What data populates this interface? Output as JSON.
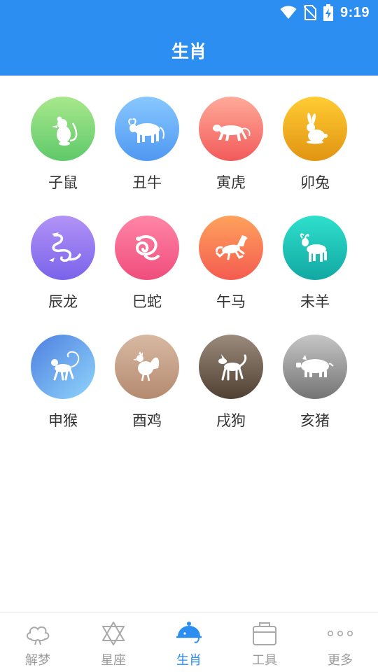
{
  "status": {
    "time": "9:19"
  },
  "header": {
    "title": "生肖"
  },
  "zodiac": [
    {
      "label": "子鼠",
      "icon": "rat-icon",
      "c1": "#a8e88c",
      "c2": "#5fc96a"
    },
    {
      "label": "丑牛",
      "icon": "ox-icon",
      "c1": "#88c8ff",
      "c2": "#4f98f2"
    },
    {
      "label": "寅虎",
      "icon": "tiger-icon",
      "c1": "#ffab9a",
      "c2": "#f25a5a"
    },
    {
      "label": "卯兔",
      "icon": "rabbit-icon",
      "c1": "#ffcc33",
      "c2": "#e19412"
    },
    {
      "label": "辰龙",
      "icon": "dragon-icon",
      "c1": "#b293f6",
      "c2": "#7a63ea"
    },
    {
      "label": "巳蛇",
      "icon": "snake-icon",
      "c1": "#ff86a6",
      "c2": "#ef4d7c"
    },
    {
      "label": "午马",
      "icon": "horse-icon",
      "c1": "#ffa25c",
      "c2": "#f45b50"
    },
    {
      "label": "未羊",
      "icon": "goat-icon",
      "c1": "#2ee0cc",
      "c2": "#12a8a2"
    },
    {
      "label": "申猴",
      "icon": "monkey-icon",
      "c1": "#4f7fe0",
      "c2": "#8fd5fb"
    },
    {
      "label": "酉鸡",
      "icon": "rooster-icon",
      "c1": "#d8b9a2",
      "c2": "#b48a70"
    },
    {
      "label": "戌狗",
      "icon": "dog-icon",
      "c1": "#9a8b7c",
      "c2": "#4f4032"
    },
    {
      "label": "亥猪",
      "icon": "pig-icon",
      "c1": "#c6c6c6",
      "c2": "#747474"
    }
  ],
  "tabs": [
    {
      "label": "解梦",
      "icon": "cloud-icon",
      "active": false
    },
    {
      "label": "星座",
      "icon": "star-of-david-icon",
      "active": false
    },
    {
      "label": "生肖",
      "icon": "zodiac-dish-icon",
      "active": true
    },
    {
      "label": "工具",
      "icon": "toolbox-icon",
      "active": false
    },
    {
      "label": "更多",
      "icon": "more-dots-icon",
      "active": false
    }
  ],
  "colors": {
    "primary": "#2b8ef0",
    "inactive": "#9a9a9a",
    "label": "#333333"
  }
}
